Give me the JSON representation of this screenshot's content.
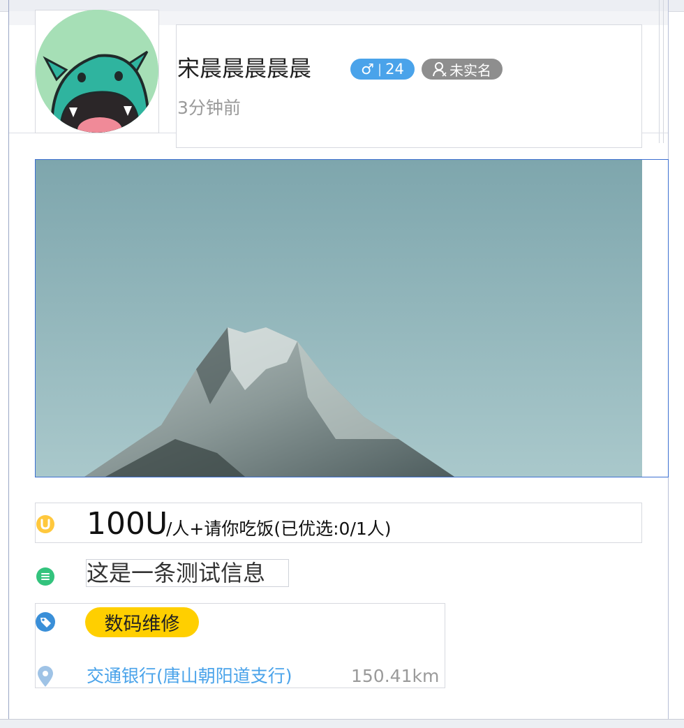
{
  "post": {
    "user": {
      "name": "宋晨晨晨晨晨",
      "gender_symbol": "♂",
      "age": "24",
      "verify_status": "未实名"
    },
    "time": "3分钟前",
    "reward": {
      "amount": "100U",
      "detail": "/人+请你吃饭(已优选:0/1人)"
    },
    "description": "这是一条测试信息",
    "category": "数码维修",
    "location": {
      "name": "交通银行(唐山朝阳道支行)",
      "distance": "150.41km"
    }
  },
  "colors": {
    "accent_blue": "#4aa3ea",
    "reward_yellow": "#ffc83d",
    "desc_green": "#33c37d",
    "tag_yellow": "#ffcf00",
    "badge_gray": "#8e8e8e",
    "pin_lightblue": "#9fc3e6"
  },
  "icons": {
    "avatar": "green-monster-avatar",
    "reward": "coin-u-icon",
    "description": "list-lines-icon",
    "category": "tag-icon",
    "location": "map-pin-icon",
    "verify": "user-icon"
  }
}
